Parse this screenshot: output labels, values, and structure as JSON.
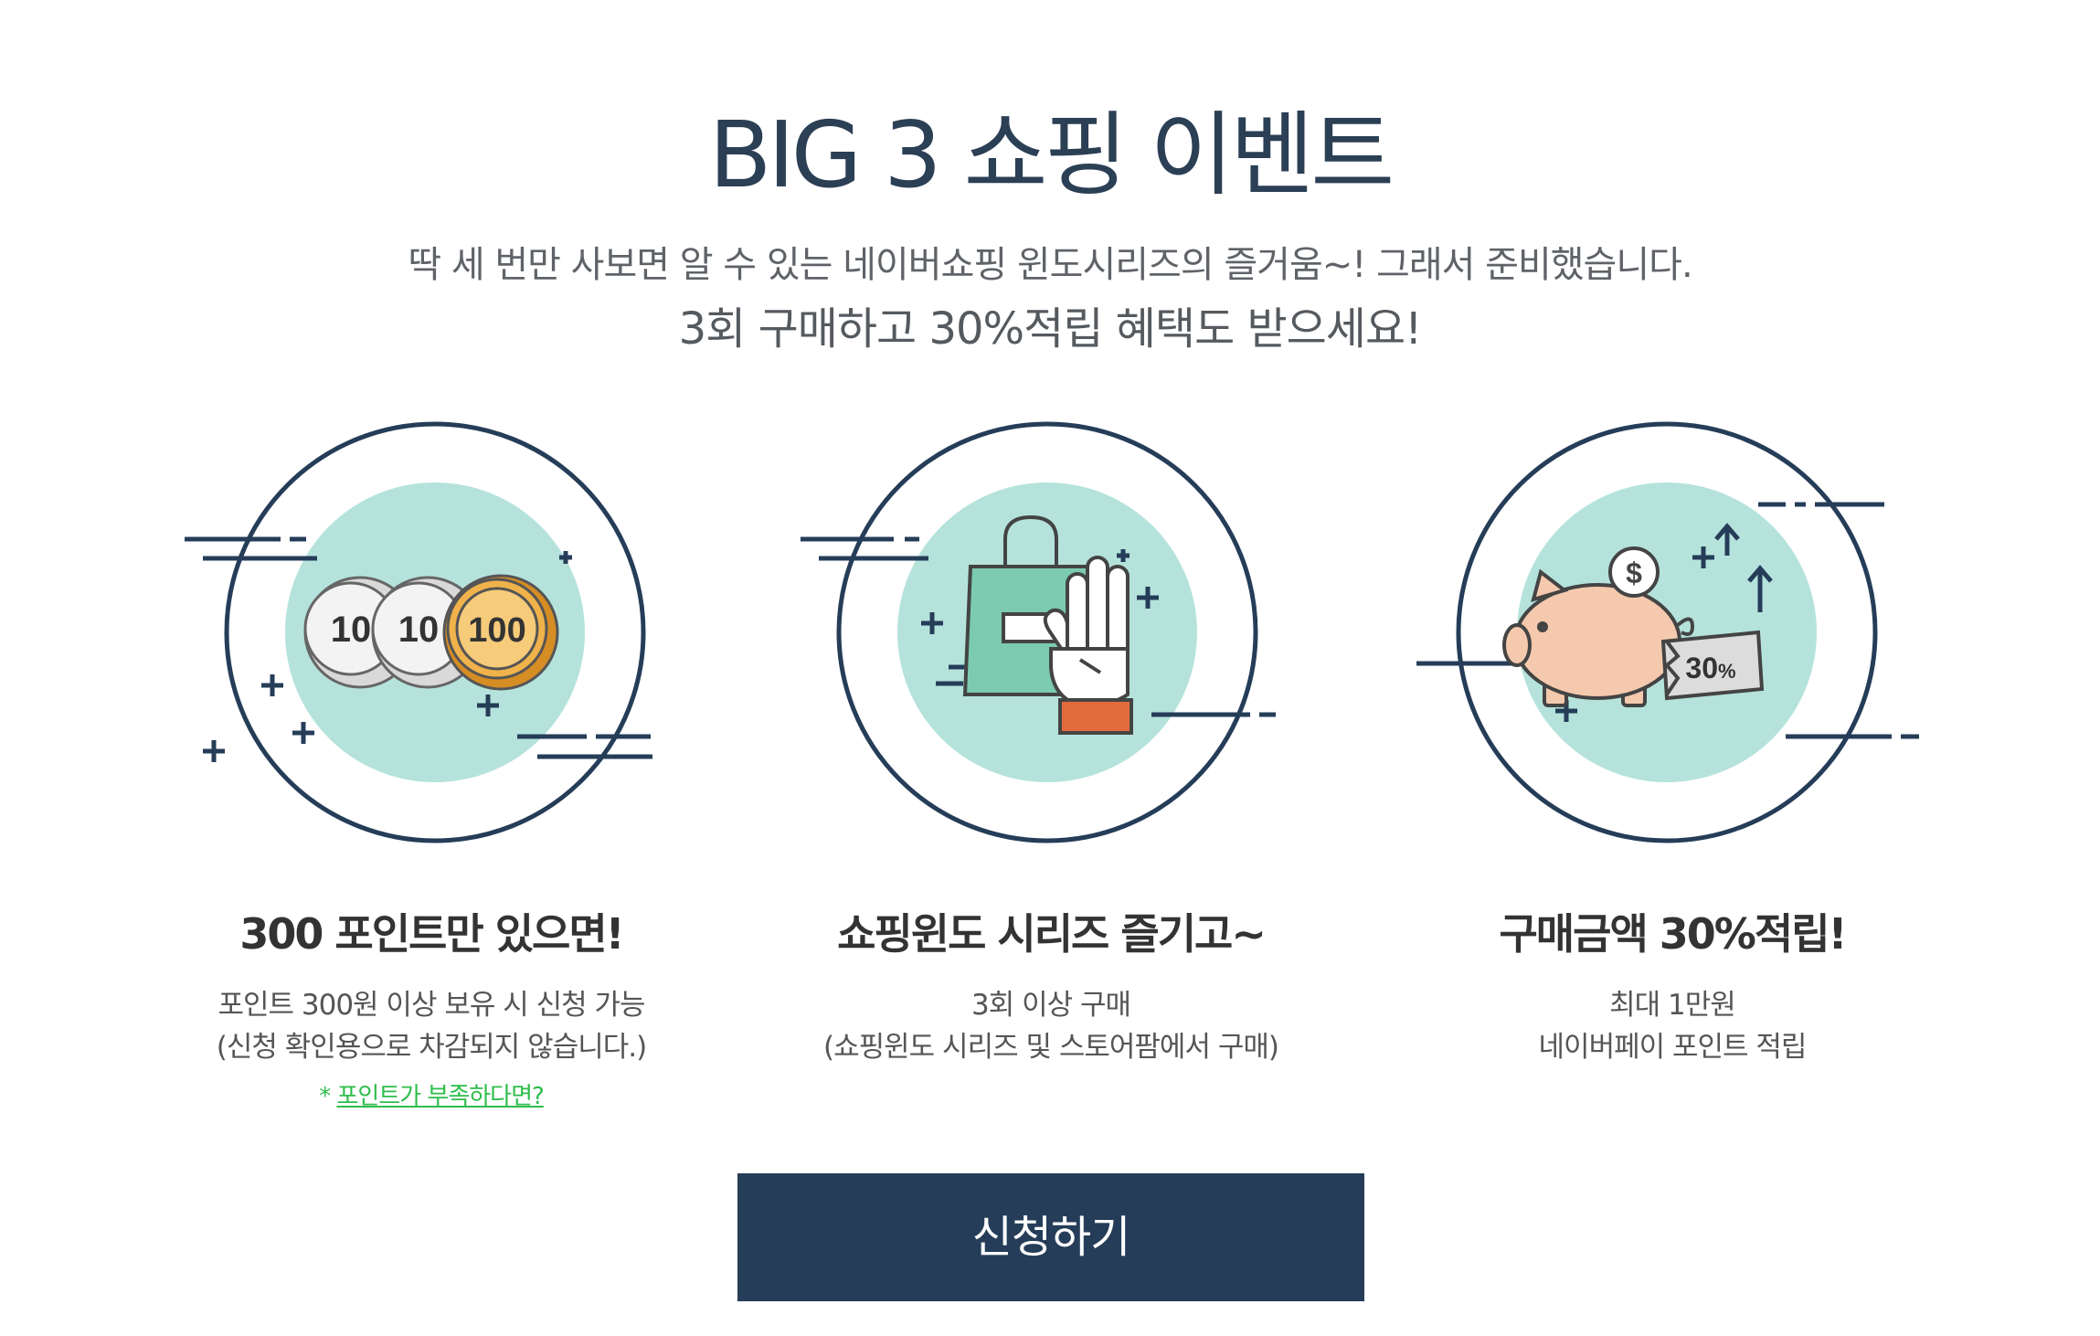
{
  "header": {
    "title": "BIG 3 쇼핑 이벤트",
    "subtitle_line1": "딱 세 번만 사보면 알 수 있는 네이버쇼핑 윈도시리즈의 즐거움~! 그래서 준비했습니다.",
    "subtitle_line2": "3회 구매하고 30%적립 혜택도 받으세요!"
  },
  "features": [
    {
      "icon": "coins-icon",
      "coin_values": [
        "10",
        "10",
        "100"
      ],
      "title": "300 포인트만 있으면!",
      "desc_line1": "포인트 300원 이상 보유 시 신청 가능",
      "desc_line2": "(신청 확인용으로 차감되지 않습니다.)",
      "link_marker": "*",
      "link_text": "포인트가 부족하다면?"
    },
    {
      "icon": "shopping-bag-hand-icon",
      "title": "쇼핑윈도 시리즈 즐기고~",
      "desc_line1": "3회 이상 구매",
      "desc_line2": "(쇼핑윈도 시리즈 및 스토어팜에서 구매)"
    },
    {
      "icon": "piggy-bank-icon",
      "coin_symbol": "$",
      "tag_value": "30",
      "tag_unit": "%",
      "title": "구매금액 30%적립!",
      "desc_line1": "최대 1만원",
      "desc_line2": "네이버페이 포인트 적립"
    }
  ],
  "apply_button": {
    "label": "신청하기"
  },
  "colors": {
    "navy": "#253d58",
    "mint": "#b5e3dc",
    "gold": "#e8a43a",
    "pig": "#f4c9ad",
    "green_link": "#2ebd4c"
  }
}
